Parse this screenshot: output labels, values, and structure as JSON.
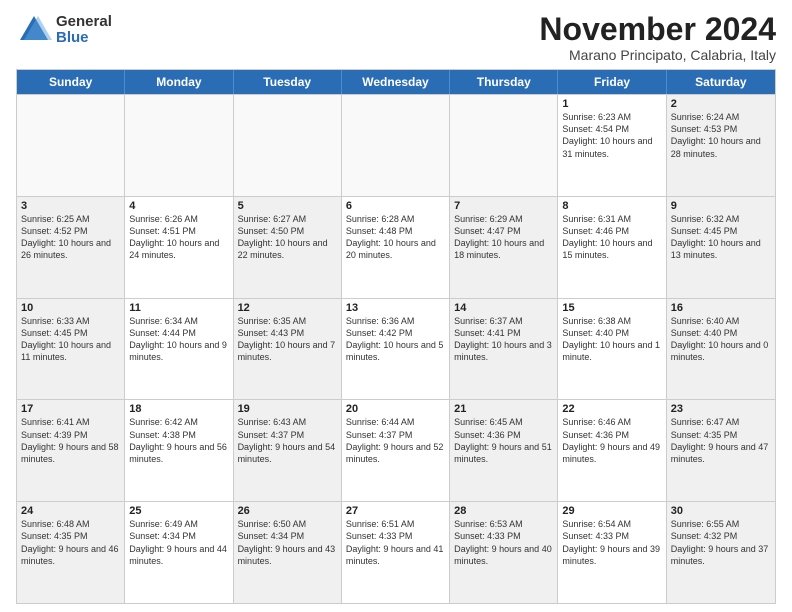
{
  "logo": {
    "general": "General",
    "blue": "Blue"
  },
  "title": "November 2024",
  "location": "Marano Principato, Calabria, Italy",
  "days_of_week": [
    "Sunday",
    "Monday",
    "Tuesday",
    "Wednesday",
    "Thursday",
    "Friday",
    "Saturday"
  ],
  "weeks": [
    [
      {
        "day": "",
        "empty": true
      },
      {
        "day": "",
        "empty": true
      },
      {
        "day": "",
        "empty": true
      },
      {
        "day": "",
        "empty": true
      },
      {
        "day": "",
        "empty": true
      },
      {
        "day": "1",
        "sunrise": "6:23 AM",
        "sunset": "4:54 PM",
        "daylight": "10 hours and 31 minutes."
      },
      {
        "day": "2",
        "sunrise": "6:24 AM",
        "sunset": "4:53 PM",
        "daylight": "10 hours and 28 minutes."
      }
    ],
    [
      {
        "day": "3",
        "sunrise": "6:25 AM",
        "sunset": "4:52 PM",
        "daylight": "10 hours and 26 minutes."
      },
      {
        "day": "4",
        "sunrise": "6:26 AM",
        "sunset": "4:51 PM",
        "daylight": "10 hours and 24 minutes."
      },
      {
        "day": "5",
        "sunrise": "6:27 AM",
        "sunset": "4:50 PM",
        "daylight": "10 hours and 22 minutes."
      },
      {
        "day": "6",
        "sunrise": "6:28 AM",
        "sunset": "4:48 PM",
        "daylight": "10 hours and 20 minutes."
      },
      {
        "day": "7",
        "sunrise": "6:29 AM",
        "sunset": "4:47 PM",
        "daylight": "10 hours and 18 minutes."
      },
      {
        "day": "8",
        "sunrise": "6:31 AM",
        "sunset": "4:46 PM",
        "daylight": "10 hours and 15 minutes."
      },
      {
        "day": "9",
        "sunrise": "6:32 AM",
        "sunset": "4:45 PM",
        "daylight": "10 hours and 13 minutes."
      }
    ],
    [
      {
        "day": "10",
        "sunrise": "6:33 AM",
        "sunset": "4:45 PM",
        "daylight": "10 hours and 11 minutes."
      },
      {
        "day": "11",
        "sunrise": "6:34 AM",
        "sunset": "4:44 PM",
        "daylight": "10 hours and 9 minutes."
      },
      {
        "day": "12",
        "sunrise": "6:35 AM",
        "sunset": "4:43 PM",
        "daylight": "10 hours and 7 minutes."
      },
      {
        "day": "13",
        "sunrise": "6:36 AM",
        "sunset": "4:42 PM",
        "daylight": "10 hours and 5 minutes."
      },
      {
        "day": "14",
        "sunrise": "6:37 AM",
        "sunset": "4:41 PM",
        "daylight": "10 hours and 3 minutes."
      },
      {
        "day": "15",
        "sunrise": "6:38 AM",
        "sunset": "4:40 PM",
        "daylight": "10 hours and 1 minute."
      },
      {
        "day": "16",
        "sunrise": "6:40 AM",
        "sunset": "4:40 PM",
        "daylight": "10 hours and 0 minutes."
      }
    ],
    [
      {
        "day": "17",
        "sunrise": "6:41 AM",
        "sunset": "4:39 PM",
        "daylight": "9 hours and 58 minutes."
      },
      {
        "day": "18",
        "sunrise": "6:42 AM",
        "sunset": "4:38 PM",
        "daylight": "9 hours and 56 minutes."
      },
      {
        "day": "19",
        "sunrise": "6:43 AM",
        "sunset": "4:37 PM",
        "daylight": "9 hours and 54 minutes."
      },
      {
        "day": "20",
        "sunrise": "6:44 AM",
        "sunset": "4:37 PM",
        "daylight": "9 hours and 52 minutes."
      },
      {
        "day": "21",
        "sunrise": "6:45 AM",
        "sunset": "4:36 PM",
        "daylight": "9 hours and 51 minutes."
      },
      {
        "day": "22",
        "sunrise": "6:46 AM",
        "sunset": "4:36 PM",
        "daylight": "9 hours and 49 minutes."
      },
      {
        "day": "23",
        "sunrise": "6:47 AM",
        "sunset": "4:35 PM",
        "daylight": "9 hours and 47 minutes."
      }
    ],
    [
      {
        "day": "24",
        "sunrise": "6:48 AM",
        "sunset": "4:35 PM",
        "daylight": "9 hours and 46 minutes."
      },
      {
        "day": "25",
        "sunrise": "6:49 AM",
        "sunset": "4:34 PM",
        "daylight": "9 hours and 44 minutes."
      },
      {
        "day": "26",
        "sunrise": "6:50 AM",
        "sunset": "4:34 PM",
        "daylight": "9 hours and 43 minutes."
      },
      {
        "day": "27",
        "sunrise": "6:51 AM",
        "sunset": "4:33 PM",
        "daylight": "9 hours and 41 minutes."
      },
      {
        "day": "28",
        "sunrise": "6:53 AM",
        "sunset": "4:33 PM",
        "daylight": "9 hours and 40 minutes."
      },
      {
        "day": "29",
        "sunrise": "6:54 AM",
        "sunset": "4:33 PM",
        "daylight": "9 hours and 39 minutes."
      },
      {
        "day": "30",
        "sunrise": "6:55 AM",
        "sunset": "4:32 PM",
        "daylight": "9 hours and 37 minutes."
      }
    ]
  ],
  "labels": {
    "sunrise": "Sunrise:",
    "sunset": "Sunset:",
    "daylight": "Daylight:"
  }
}
